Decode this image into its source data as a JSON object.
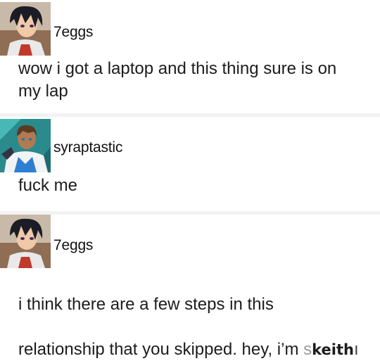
{
  "posts": [
    {
      "username": "7eggs",
      "avatar_icon": "keith-avatar-icon",
      "text": "wow i got a laptop and this thing sure is on\nmy lap"
    },
    {
      "username": "syraptastic",
      "avatar_icon": "lance-avatar-icon",
      "text": "fuck me"
    },
    {
      "username": "7eggs",
      "avatar_icon": "keith-avatar-icon",
      "text_line1": "i think there are a few steps in this",
      "text_line2": "relationship that you skipped. hey, i’m ",
      "text_cut": "s",
      "text_overlay": "keith",
      "text_tail": "ı"
    }
  ]
}
